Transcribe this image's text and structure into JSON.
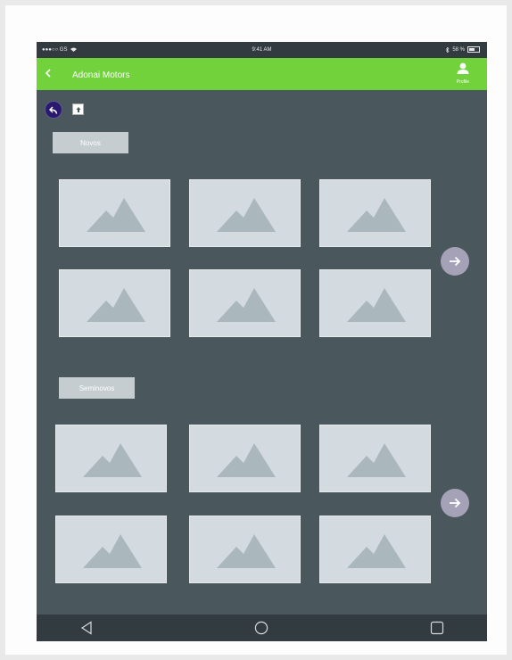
{
  "status_bar": {
    "carrier": "●●●○○ GS",
    "time": "9:41 AM",
    "battery": "58 %"
  },
  "app_bar": {
    "title": "Adonai Motors",
    "profile_label": "Profile"
  },
  "sections": [
    {
      "label": "Novos"
    },
    {
      "label": "Seminovos"
    }
  ],
  "icons": {
    "back": "chevron-left-icon",
    "profile": "person-icon",
    "undo": "undo-icon",
    "upload": "upload-icon",
    "thumbnail": "image-placeholder-icon",
    "next": "arrow-right-icon",
    "nav_back": "triangle-back-icon",
    "nav_home": "circle-home-icon",
    "nav_recent": "square-recent-icon"
  },
  "colors": {
    "accent": "#71d23c",
    "background": "#4a575c",
    "system_bar": "#323b40",
    "thumbnail": "#d3dbe0",
    "next_button": "#a5a1b7",
    "undo_button": "#2a1a6e"
  }
}
